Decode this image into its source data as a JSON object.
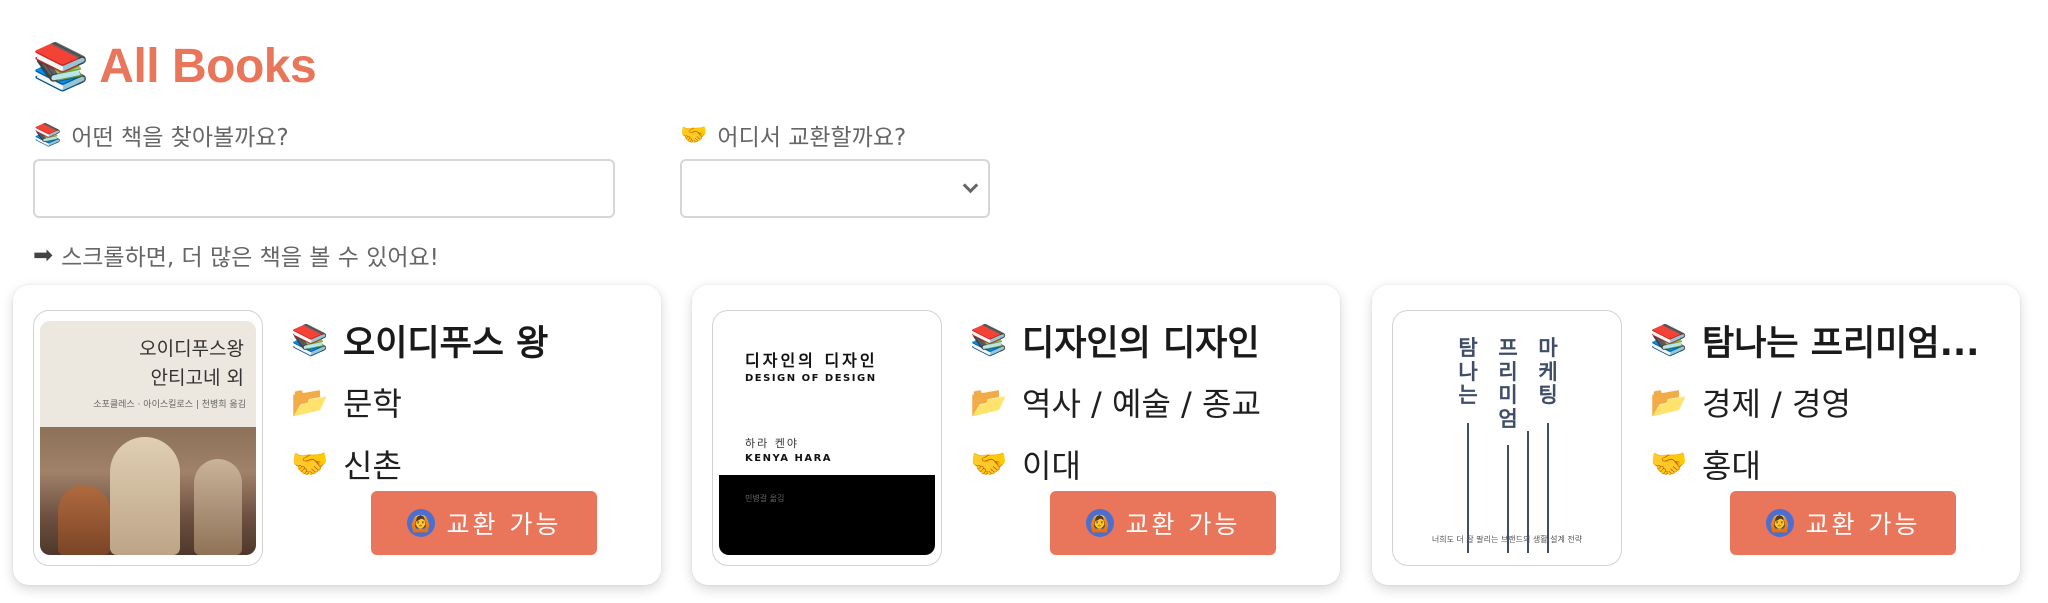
{
  "header": {
    "icon": "📚",
    "title": "All Books"
  },
  "filters": {
    "search": {
      "icon": "📚",
      "label": "어떤 책을 찾아볼까요?",
      "value": "",
      "placeholder": ""
    },
    "location": {
      "icon": "🤝",
      "label": "어디서 교환할까요?",
      "selected": ""
    }
  },
  "hint": {
    "arrow": "➡",
    "text": "스크롤하면, 더 많은 책을 볼 수 있어요!"
  },
  "books": [
    {
      "title_icon": "📚",
      "title": "오이디푸스 왕",
      "category_icon": "📂",
      "category": "문학",
      "location_icon": "🤝",
      "location": "신촌",
      "button_badge": "🙆",
      "button_label": "교환 가능",
      "cover": {
        "title_lines": [
          "오이디푸스왕",
          "안티고네 외"
        ],
        "author": "소포클레스 · 아이스킬로스 | 천병희 옮김"
      }
    },
    {
      "title_icon": "📚",
      "title": "디자인의 디자인",
      "category_icon": "📂",
      "category": "역사 / 예술 / 종교",
      "location_icon": "🤝",
      "location": "이대",
      "button_badge": "🙆",
      "button_label": "교환 가능",
      "cover": {
        "title_ko": "디자인의 디자인",
        "title_en": "DESIGN OF DESIGN",
        "author_ko": "하라 켄야",
        "author_en": "KENYA HARA",
        "translator": "민병걸 옮김"
      }
    },
    {
      "title_icon": "📚",
      "title": "탐나는 프리미엄...",
      "category_icon": "📂",
      "category": "경제 / 경영",
      "location_icon": "🤝",
      "location": "홍대",
      "button_badge": "🙆",
      "button_label": "교환 가능",
      "cover": {
        "col1": "탐나는",
        "col2": "프리미엄",
        "col3": "마케팅",
        "subtitle": "너희도 더 잘 팔리는 브랜드의 생활 설계 전략"
      }
    }
  ]
}
